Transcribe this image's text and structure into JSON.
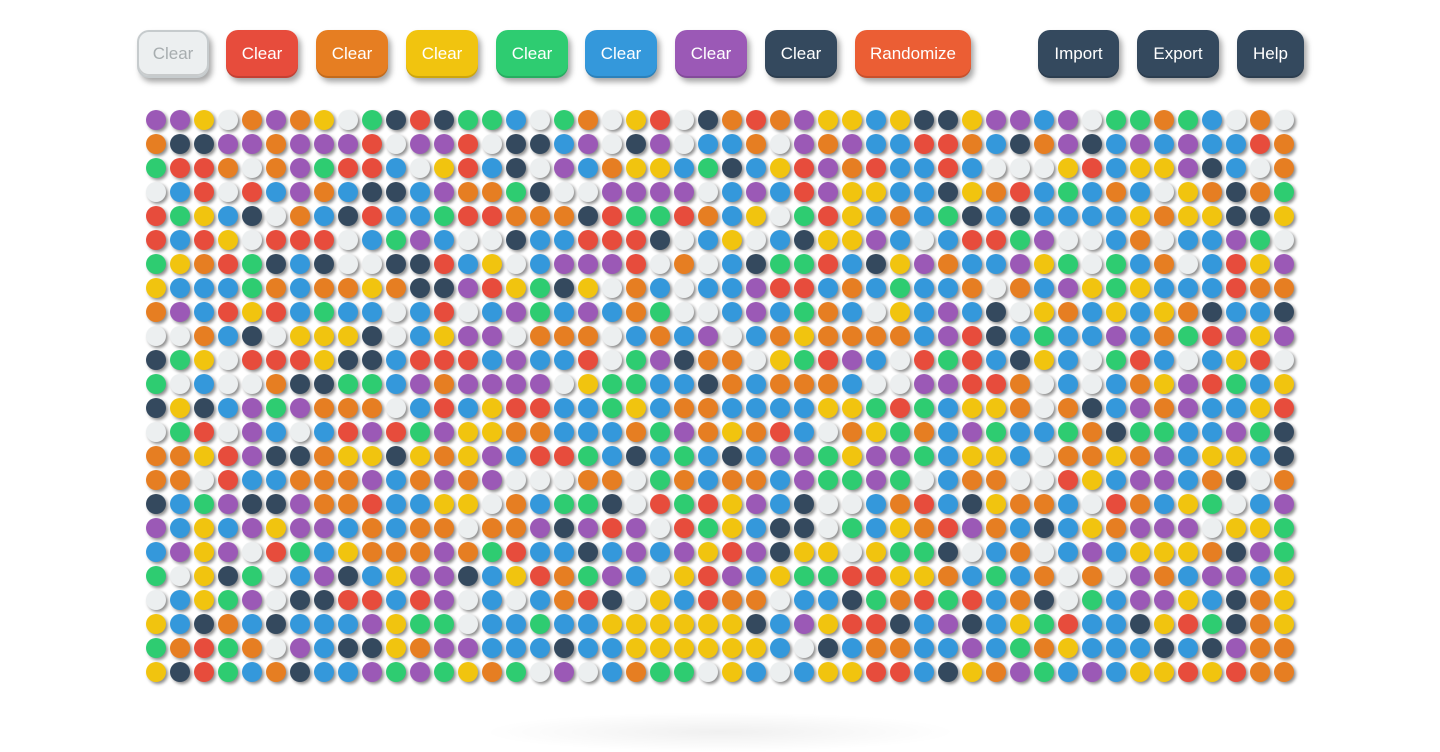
{
  "toolbar": {
    "clear_white_label": "Clear",
    "clear_red_label": "Clear",
    "clear_orange_label": "Clear",
    "clear_yellow_label": "Clear",
    "clear_green_label": "Clear",
    "clear_blue_label": "Clear",
    "clear_purple_label": "Clear",
    "clear_navy_label": "Clear",
    "randomize_label": "Randomize",
    "import_label": "Import",
    "export_label": "Export",
    "help_label": "Help"
  },
  "palette": {
    "w": "#eceff0",
    "r": "#e74c3c",
    "o": "#e67e22",
    "y": "#f1c40f",
    "g": "#2ecc71",
    "b": "#3498db",
    "p": "#9b59b6",
    "n": "#34495e",
    "randomize": "#eb5e34"
  },
  "grid": {
    "columns": 48,
    "rows": 24,
    "cells": [
      "ppywopoywgnrnggbwgowyrwnorop yybynnyppbpwggogbwo",
      "onnppoppprwpprwnnbpwnpwbbowpopbbrrobnopnbpbpbbro",
      "grrowopgrrbwyrbnwpboyybgnbyrporbbrbwwwyrbyypnbwo",
      "wbrwrbpobnnbpoognwwppppwbpbrpyybbnyorbgbobwyonog",
      "rgybnwobnrbbgrrooonrggrobywgrybobgnbnbbbbyoyynny",
      "rbrywrrrwbgpbwwnbbrrrnwbyw bnyypbwbrrgpwwbowbbpg",
      "gyorgnbnwwnnrbywbppprwowbnggrbnypobbpygwgbowbryp",
      "ybbbgobooyonnprygnywobwbbprrbobgbbowobpygybbbroo",
      "opbryrbgbbwbrwbpgbpbogwwbpbgobwybpbnwyobybyonbbn",
      "wwobnwyyynwbyppwooowbobpwboyoooobprnbgbbpbogrpyp",
      "ngywrrrynnbrrrbpbbrwgpnoowygrpbwrgrbnybwgrbwbyrw",
      "gwbwwonnggbpoppppwyggbbnobooobwwpprrowbwboyprgby",
      "nynbpgpooowbrbyrrbbgyboobbbbyygrgbyyowonbpopbbyr",
      "wgrwpbwbrprgpyyoobbbogpoyorbwoygobpgbbgonggbbpgn",
      "ooyrpnnoyynyoypbrrgbnbgbnbppgyppgbyybwooyopbyybn",
      "oowrbbooopbopopwwwoowgoboobpggpgwboowwrybppbonwo",
      "nbgpnnpoorbbyywobggnwrgrypbnwwborbnyoobwrobygwbp",
      "pbybpyppboboowoopnprpwrgybnnwgbyorpobnbyopppwyyg",
      "bpypwrgbyooopogrbbnbpbpyrpnyywyggnwbowbpbyyyonpg",
      "gwyngwbpnbyppnbyrogpbwyrpbyggrryyobgbowowpobppby",
      "wbygpwnnrrbrpwbwbornwybroowbbngorgrbonwgbppybnoy",
      "ybnobnbbbpyggwbbgbbyyyyyynbpyrrnbpnbygrbbnyrgnoy",
      "gorgowpbnnyoppbbbnbbyyyyyybwnboobbpbgoybbbnbnpoo",
      "ynrgbonbbpgpgyogwpwboggwybwbyyrrbnyopgbpbyyryroo"
    ]
  }
}
